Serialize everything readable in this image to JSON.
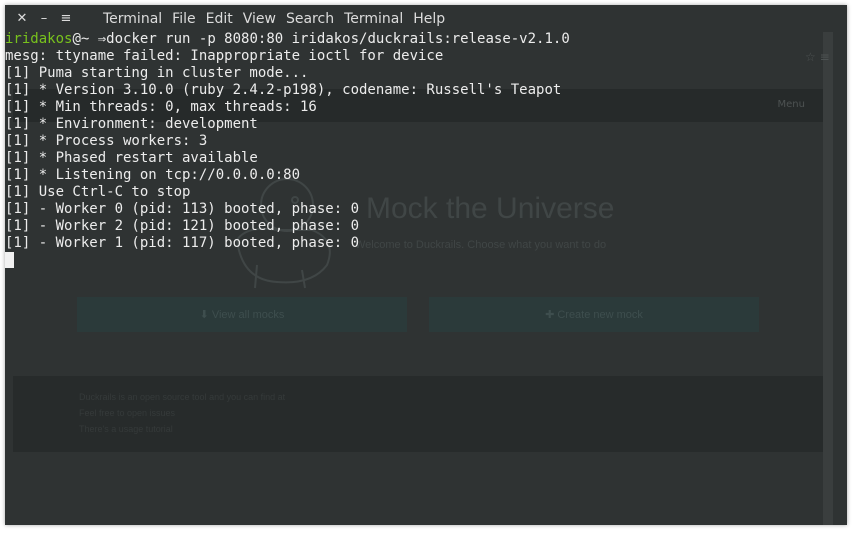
{
  "window": {
    "controls": {
      "close": "✕",
      "minimize": "–",
      "menu": "≡"
    },
    "menus": [
      "Terminal",
      "File",
      "Edit",
      "View",
      "Search",
      "Terminal",
      "Help"
    ]
  },
  "terminal": {
    "prompt": {
      "user": "iridakos",
      "suffix": "@~",
      "arrow": "⇒",
      "command": "docker run -p 8080:80 iridakos/duckrails:release-v2.1.0"
    },
    "lines": [
      "mesg: ttyname failed: Inappropriate ioctl for device",
      "[1] Puma starting in cluster mode...",
      "[1] * Version 3.10.0 (ruby 2.4.2-p198), codename: Russell's Teapot",
      "[1] * Min threads: 0, max threads: 16",
      "[1] * Environment: development",
      "[1] * Process workers: 3",
      "[1] * Phased restart available",
      "[1] * Listening on tcp://0.0.0.0:80",
      "[1] Use Ctrl-C to stop",
      "[1] - Worker 0 (pid: 113) booted, phase: 0",
      "[1] - Worker 2 (pid: 121) booted, phase: 0",
      "[1] - Worker 1 (pid: 117) booted, phase: 0"
    ]
  },
  "background_page": {
    "nav_label": "Menu",
    "title": "Mock the Universe",
    "subtitle": "Welcome to Duckrails. Choose what you want to do",
    "buttons": [
      "⬇ View all mocks",
      "✚ Create new mock"
    ],
    "footer": [
      "Duckrails is an open source tool and you can find at",
      "Feel free to open issues",
      "There's a usage tutorial"
    ]
  },
  "colors": {
    "background": "#2f3333",
    "prompt_user": "#78c21d",
    "text": "#ececec"
  }
}
